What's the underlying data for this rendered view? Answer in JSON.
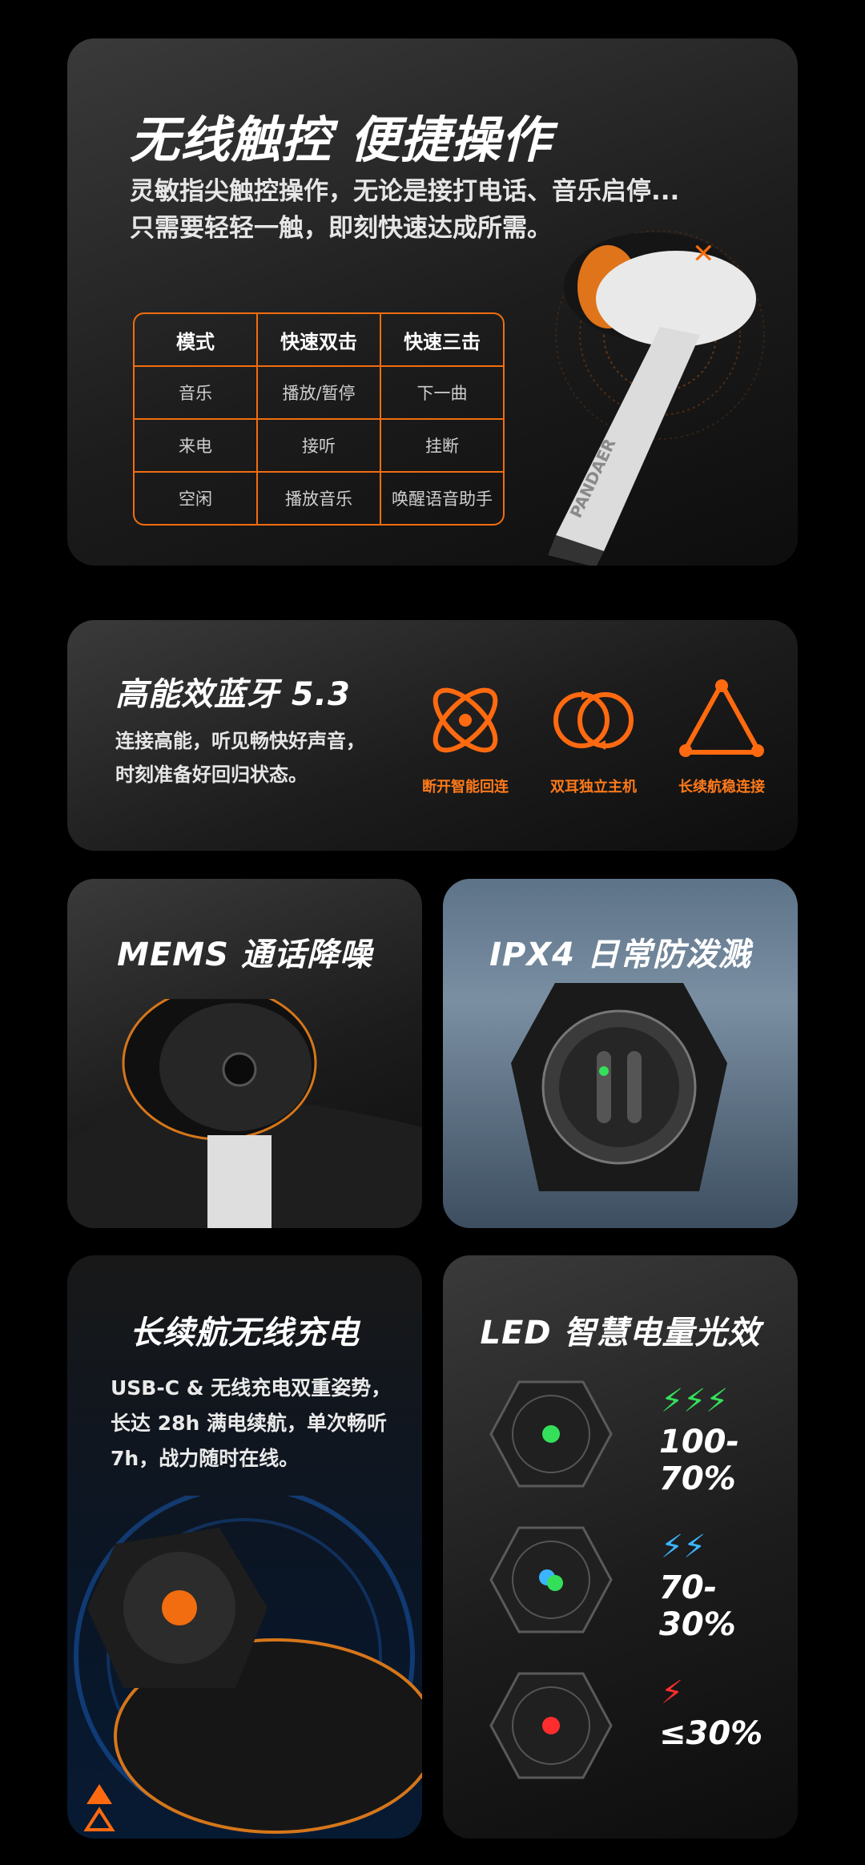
{
  "touch": {
    "title": "无线触控 便捷操作",
    "desc1": "灵敏指尖触控操作，无论是接打电话、音乐启停...",
    "desc2": "只需要轻轻一触，即刻快速达成所需。",
    "table": {
      "headers": [
        "模式",
        "快速双击",
        "快速三击"
      ],
      "rows": [
        [
          "音乐",
          "播放/暂停",
          "下一曲"
        ],
        [
          "来电",
          "接听",
          "挂断"
        ],
        [
          "空闲",
          "播放音乐",
          "唤醒语音助手"
        ]
      ]
    },
    "brand_print": "PANDAER"
  },
  "bluetooth": {
    "title": "高能效蓝牙 5.3",
    "desc1": "连接高能，听见畅快好声音，",
    "desc2": "时刻准备好回归状态。",
    "features": [
      "断开智能回连",
      "双耳独立主机",
      "长续航稳连接"
    ]
  },
  "mems": {
    "title": "MEMS 通话降噪"
  },
  "ipx": {
    "title": "IPX4 日常防泼溅"
  },
  "charge": {
    "title": "长续航无线充电",
    "desc1": "USB-C & 无线充电双重姿势，",
    "desc2": "长达 28h 满电续航，单次畅听",
    "desc3": "7h，战力随时在线。"
  },
  "led": {
    "title": "LED 智慧电量光效",
    "levels": [
      {
        "label": "100-70%",
        "bolts": "⚡⚡⚡",
        "color": "#34e05a"
      },
      {
        "label": "70-30%",
        "bolts": "⚡⚡",
        "color": "#3cb4ff"
      },
      {
        "label": "≤30%",
        "bolts": "⚡",
        "color": "#ff2d2d"
      }
    ]
  },
  "colors": {
    "accent": "#f26d0f"
  }
}
